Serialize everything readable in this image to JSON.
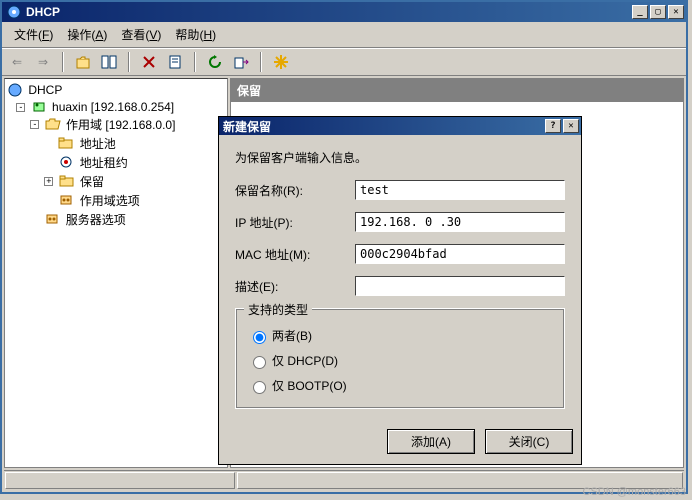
{
  "window": {
    "title": "DHCP"
  },
  "menu": {
    "file": "文件",
    "file_key": "F",
    "action": "操作",
    "action_key": "A",
    "view": "查看",
    "view_key": "V",
    "help": "帮助",
    "help_key": "H"
  },
  "tree": {
    "root": "DHCP",
    "server": "huaxin [192.168.0.254]",
    "scope": "作用域 [192.168.0.0]",
    "pool": "地址池",
    "lease": "地址租约",
    "reservation": "保留",
    "scope_options": "作用域选项",
    "server_options": "服务器选项"
  },
  "pane": {
    "header": "保留"
  },
  "dialog": {
    "title": "新建保留",
    "instruction": "为保留客户端输入信息。",
    "name_label": "保留名称(R):",
    "name_value": "test",
    "ip_label": "IP 地址(P):",
    "ip_value": "192.168. 0 .30",
    "mac_label": "MAC 地址(M):",
    "mac_value": "000c2904bfad",
    "desc_label": "描述(E):",
    "desc_value": "",
    "group_title": "支持的类型",
    "radio_both": "两者(B)",
    "radio_dhcp": "仅 DHCP(D)",
    "radio_bootp": "仅 BOOTP(O)",
    "btn_add": "添加(A)",
    "btn_close": "关闭(C)"
  },
  "watermark": "CSDN @monster663"
}
